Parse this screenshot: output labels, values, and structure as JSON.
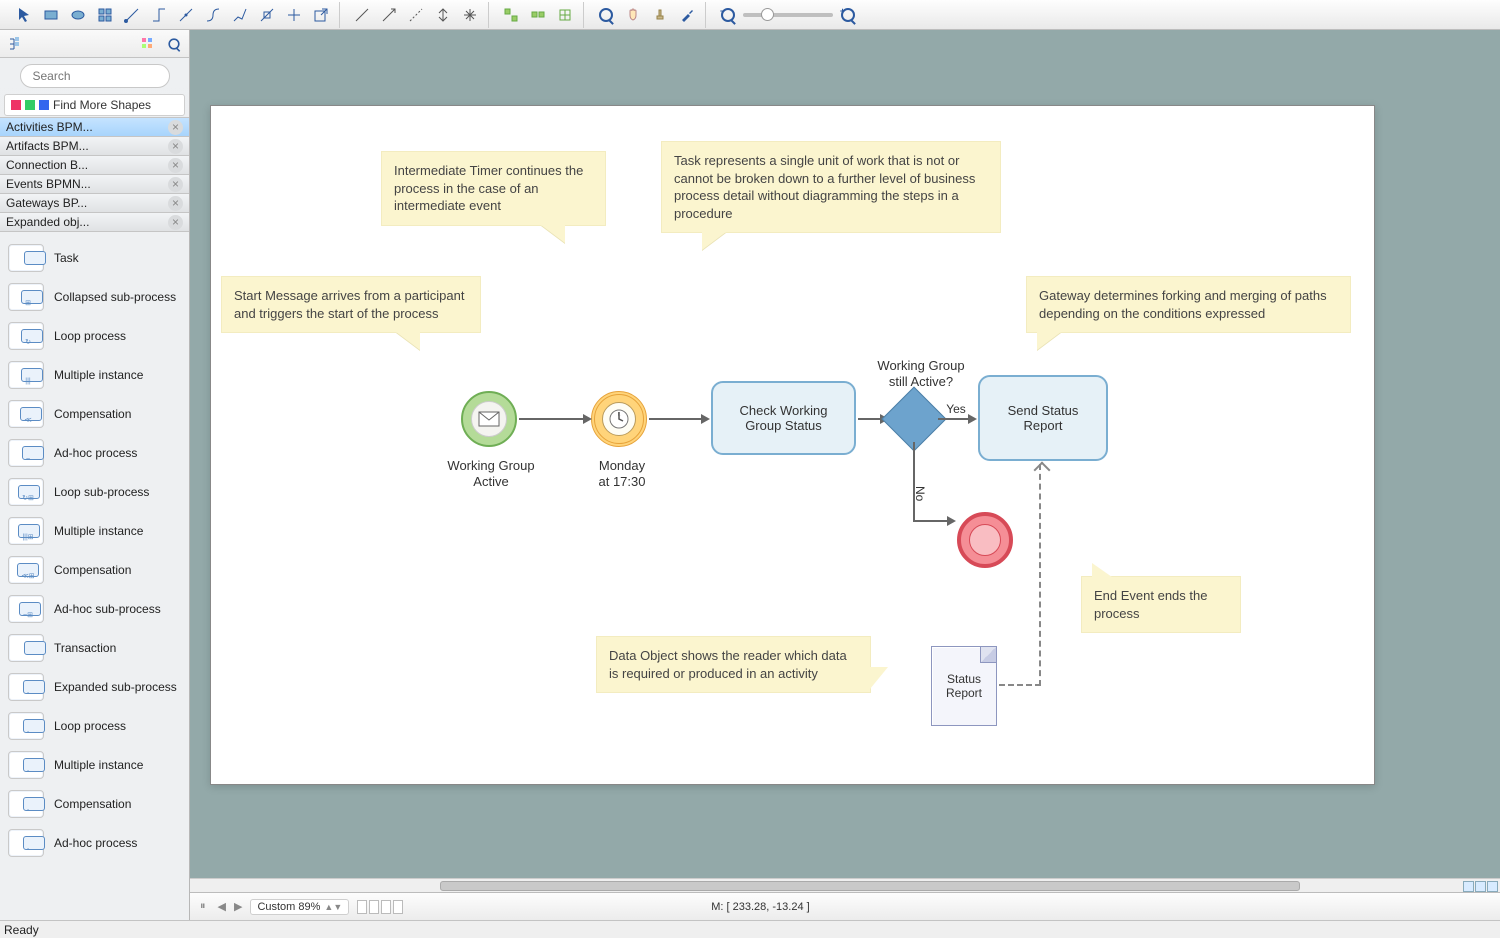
{
  "toolbar": {
    "groups": [
      [
        "pointer-icon",
        "rectangle-icon",
        "ellipse-icon",
        "grid-icon",
        "connector1-icon",
        "connector2-icon",
        "connector3-icon",
        "connector4-icon",
        "connector5-icon",
        "connector6-icon",
        "connector7-icon",
        "export-icon"
      ],
      [
        "line1-icon",
        "line2-icon",
        "line3-icon",
        "line4-icon",
        "line5-icon"
      ],
      [
        "arrange1-icon",
        "arrange2-icon",
        "arrange3-icon"
      ],
      [
        "zoom-icon",
        "hand-icon",
        "stamp-icon",
        "eyedropper-icon"
      ]
    ],
    "zoom_out_icon": "zoom-out-icon",
    "zoom_in_icon": "zoom-in-icon"
  },
  "sidebar_tabs": {
    "icons": [
      "tree-icon",
      "list-icon",
      "grid-icon",
      "search-icon"
    ]
  },
  "search": {
    "placeholder": "Search"
  },
  "find_more_label": "Find More Shapes",
  "stencils": [
    {
      "label": "Activities BPM...",
      "selected": true
    },
    {
      "label": "Artifacts BPM...",
      "selected": false
    },
    {
      "label": "Connection B...",
      "selected": false
    },
    {
      "label": "Events BPMN...",
      "selected": false
    },
    {
      "label": "Gateways BP...",
      "selected": false
    },
    {
      "label": "Expanded obj...",
      "selected": false
    }
  ],
  "shapes": [
    {
      "label": "Task",
      "badge": ""
    },
    {
      "label": "Collapsed sub-process",
      "badge": "⊞"
    },
    {
      "label": "Loop process",
      "badge": "↻"
    },
    {
      "label": "Multiple instance",
      "badge": "|||"
    },
    {
      "label": "Compensation",
      "badge": "≪"
    },
    {
      "label": "Ad-hoc process",
      "badge": "~"
    },
    {
      "label": "Loop sub-process",
      "badge": "↻⊞"
    },
    {
      "label": "Multiple instance",
      "badge": "|||⊞"
    },
    {
      "label": "Compensation",
      "badge": "≪⊞"
    },
    {
      "label": "Ad-hoc sub-process",
      "badge": "~⊞"
    },
    {
      "label": "Transaction",
      "badge": ""
    },
    {
      "label": "Expanded sub-process",
      "badge": "◦"
    },
    {
      "label": "Loop process",
      "badge": "◦"
    },
    {
      "label": "Multiple instance",
      "badge": "◦"
    },
    {
      "label": "Compensation",
      "badge": "◦"
    },
    {
      "label": "Ad-hoc process",
      "badge": "◦"
    }
  ],
  "diagram": {
    "notes": {
      "start": "Start Message arrives from a participant and triggers the start of the process",
      "timer": "Intermediate Timer continues the process in the case of an intermediate event",
      "task": "Task represents a single unit of work that is not or cannot be broken down to a further level of business process detail without diagramming the steps in a procedure",
      "gateway": "Gateway determines forking and merging of paths depending on the conditions expressed",
      "end": "End Event ends the process",
      "data": "Data Object shows the reader which data is required or produced in an activity"
    },
    "events": {
      "start_label": "Working Group\nActive",
      "timer_label": "Monday\nat 17:30"
    },
    "tasks": {
      "check": "Check Working Group Status",
      "send": "Send Status Report"
    },
    "gateway_label": "Working Group\nstill Active?",
    "edge_yes": "Yes",
    "edge_no": "No",
    "doc_label": "Status\nReport"
  },
  "statusbar": {
    "zoom_label": "Custom 89%",
    "mouse": "M: [ 233.28, -13.24 ]",
    "ready": "Ready"
  }
}
